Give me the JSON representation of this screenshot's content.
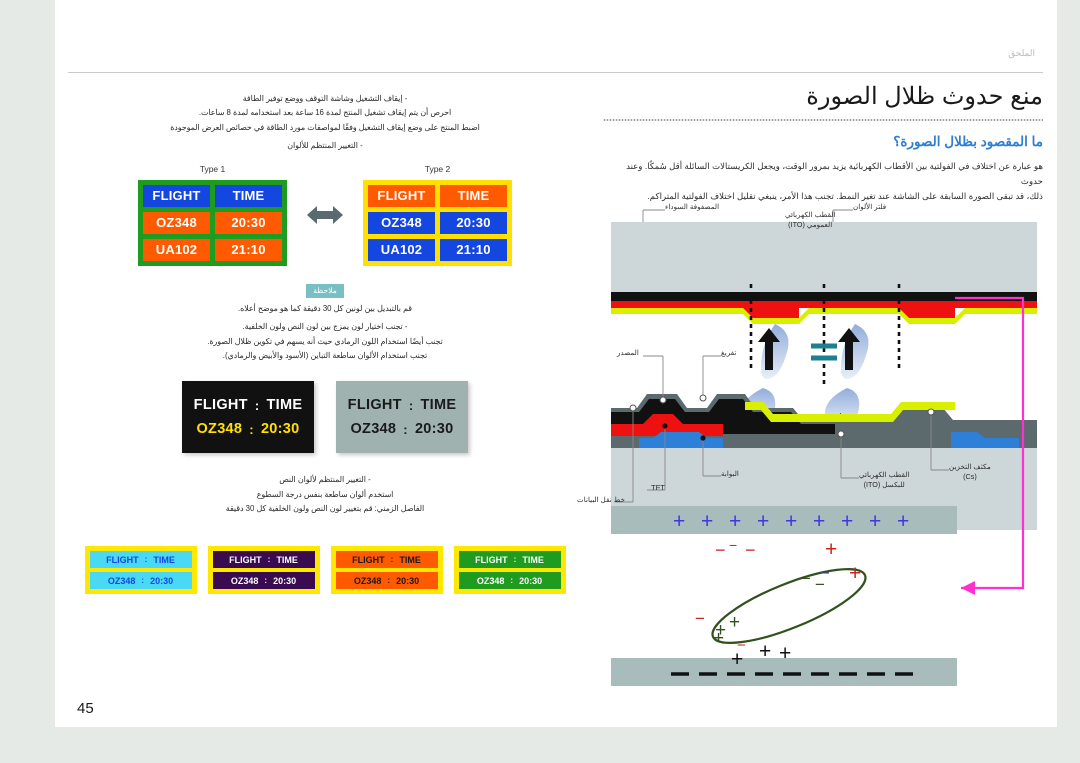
{
  "header": {
    "text": "الملحق"
  },
  "page": {
    "number": "45"
  },
  "main": {
    "title": "منع حدوث ظلال الصورة",
    "subtitle": "ما المقصود بظلال الصورة؟",
    "body_lines": [
      "هو عبارة عن اختلاف في الفولتية بين الأقطاب الكهربائية يزيد بمرور الوقت، ويجعل الكريستالات السائلة أقل سُمكًا. وعند حدوث",
      "ذلك، قد تبقى الصورة السابقة على الشاشة عند تغير النمط. تجنب هذا الأمر، ينبغي تقليل اختلاف الفولتية المتراكم."
    ]
  },
  "left": {
    "bullet1": "- إيقاف التشغيل وشاشة التوقف ووضع توفير الطاقة",
    "p1_line1": "احرص أن يتم إيقاف تشغيل المنتج لمدة 16 ساعة بعد استخدامه لمدة 8 ساعات.",
    "p1_line2": "اضبط المنتج على وضع إيقاف التشغيل وفقًا لمواصفات مورد الطاقة في خصائص العرض الموجودة",
    "bullet2": "- التغيير المنتظم للألوان",
    "note_label": "ملاحظة",
    "note_line": "قم بالتبديل بين لونين كل 30 دقيقة كما هو موضح أعلاه.",
    "note_b1": "- تجنب اختيار لون يمزج بين لون النص ولون الخلفية.",
    "note_b2": "تجنب أيضًا استخدام اللون الرمادي حيث أنه يسهم في تكوين ظلال الصورة.",
    "note_b3": "تجنب استخدام الألوان ساطعة التباين (الأسود والأبيض والرمادي).",
    "bullet3": "- التغيير المنتظم لألوان النص",
    "p3_line1": "استخدم ألوان ساطعة بنفس درجة السطوع",
    "p3_line2": "الفاصل الزمني: قم بتغيير لون النص ولون الخلفية كل 30 دقيقة"
  },
  "boards": {
    "type_labels": [
      "Type 1",
      "Type 2"
    ],
    "headers": [
      "FLIGHT",
      "TIME"
    ],
    "rows": [
      [
        "OZ348",
        "20:30"
      ],
      [
        "UA102",
        "21:10"
      ]
    ],
    "wide": [
      {
        "name": "black-board",
        "bg": "#111111",
        "head_color": "#ffffff",
        "row_color": "#ffe000",
        "flight_label": "FLIGHT",
        "time_label": "TIME",
        "flight_no": "OZ348",
        "time_val": "20:30",
        "sep": ":"
      },
      {
        "name": "gray-board",
        "bg": "#9fb2b0",
        "head_color": "#1a1a1a",
        "row_color": "#1a1a1a",
        "flight_label": "FLIGHT",
        "time_label": "TIME",
        "flight_no": "OZ348",
        "time_val": "20:30",
        "sep": ":"
      }
    ],
    "small": [
      {
        "name": "cyan-board",
        "bg": "#4ad9f5",
        "text": "#1446e0",
        "border": "#ffe800"
      },
      {
        "name": "purple-board",
        "bg": "#3b0b52",
        "text": "#ffffff",
        "border": "#ffe800"
      },
      {
        "name": "orange-board",
        "bg": "#ff5a00",
        "text": "#1a1a1a",
        "border": "#ffe800"
      },
      {
        "name": "green-board",
        "bg": "#1f9b1f",
        "text": "#ffffff",
        "border": "#ffe800"
      }
    ],
    "small_text": {
      "flight_label": "FLIGHT",
      "time_label": "TIME",
      "sep": ":",
      "flight_no": "OZ348",
      "time_val": "20:30"
    }
  },
  "diagram": {
    "labels": {
      "black_matrix": "المصفوفة السوداء",
      "common_ito_l1": "القطب الكهربائي",
      "common_ito_l2": "العمومي (ITO)",
      "color_filter": "فلتر الألوان",
      "source": "المصدر",
      "drain": "تفريغ",
      "gate": "البوابة",
      "tft": "TFT",
      "data_line": "خط نقل البيانات",
      "pixel_ito_l1": "القطب الكهربائي",
      "pixel_ito_l2": "للبكسل (ITO)",
      "storage_cap_l1": "مكثف التخزين",
      "storage_cap_l2": "(Cs)"
    },
    "colors": {
      "glass": "#cdd6d8",
      "black_matrix": "#111111",
      "red_layer": "#ee1111",
      "yellow_layer": "#d8f000",
      "blue_layer": "#2e7fd8",
      "gray_metal": "#5c6a6e",
      "electrode_bar": "#a8bcbb",
      "lc_outline": "#33501f",
      "magenta": "#ff2fd0",
      "plus_blue": "#3a3ae0",
      "minus_red": "#cc2222"
    },
    "charges": {
      "top_bar_plus_count": 9,
      "top_bar_symbol": "+",
      "bottom_bar_symbol": "−",
      "bottom_bar_minus_count": 9
    }
  }
}
